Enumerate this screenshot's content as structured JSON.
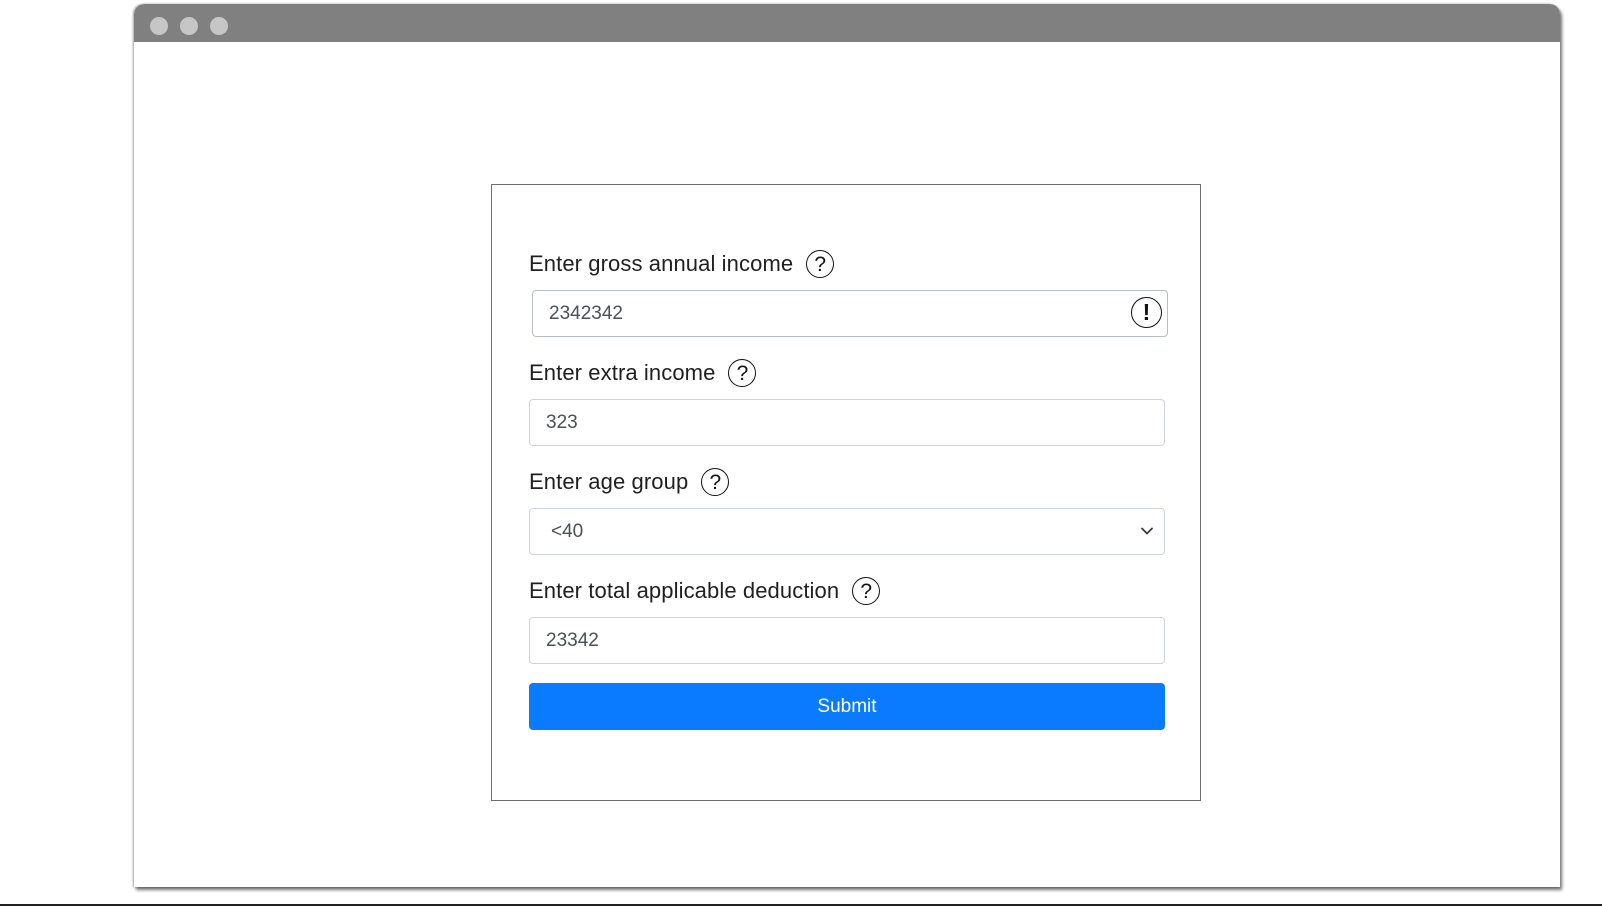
{
  "window": {
    "controls": [
      "dot",
      "dot",
      "dot"
    ]
  },
  "form": {
    "gross_income": {
      "label": "Enter gross annual income",
      "help_icon": "?",
      "value": "2342342",
      "warning_icon": "!"
    },
    "extra_income": {
      "label": "Enter extra income",
      "help_icon": "?",
      "value": "323"
    },
    "age_group": {
      "label": "Enter age group",
      "help_icon": "?",
      "selected": "<40"
    },
    "deduction": {
      "label": "Enter total applicable deduction",
      "help_icon": "?",
      "value": "23342"
    },
    "submit_label": "Submit"
  },
  "colors": {
    "titlebar": "#808080",
    "window_dot": "#c6c6c6",
    "primary_button": "#0a7bff",
    "input_text": "#495057",
    "label_text": "#1f1f1f"
  }
}
